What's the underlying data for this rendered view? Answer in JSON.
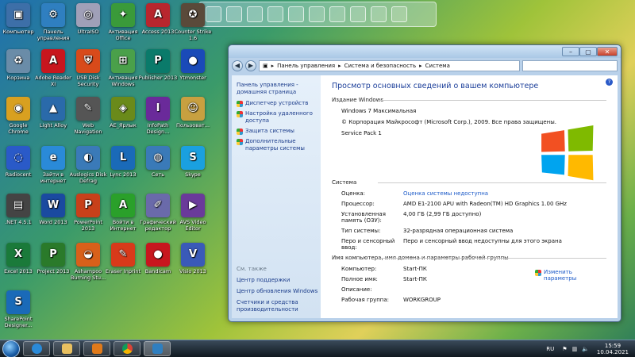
{
  "desktop_icons": [
    {
      "label": "Компьютер",
      "color": "#3d6fa8",
      "glyph": "▣"
    },
    {
      "label": "Панель управления",
      "color": "#2f7fc0",
      "glyph": "⚙"
    },
    {
      "label": "UltraISO",
      "color": "#a0a0b8",
      "glyph": "◎"
    },
    {
      "label": "Активация Office",
      "color": "#3a9a3a",
      "glyph": "✦"
    },
    {
      "label": "Access 2013",
      "color": "#b8262e",
      "glyph": "A"
    },
    {
      "label": "Counter Strike 1.6",
      "color": "#5a4a3a",
      "glyph": "✪"
    },
    {
      "label": "Корзина",
      "color": "#6a8ca8",
      "glyph": "♻"
    },
    {
      "label": "Adobe Reader XI",
      "color": "#c8161e",
      "glyph": "A"
    },
    {
      "label": "USB Disk Security",
      "color": "#d84a1a",
      "glyph": "⛨"
    },
    {
      "label": "Активация Windows",
      "color": "#4aa04a",
      "glyph": "⊞"
    },
    {
      "label": "Publisher 2013",
      "color": "#0a7a6a",
      "glyph": "P"
    },
    {
      "label": "Ytmonster",
      "color": "#1a4ab8",
      "glyph": "●"
    },
    {
      "label": "Google Chrome",
      "color": "#d8a020",
      "glyph": "◉"
    },
    {
      "label": "Light Alloy",
      "color": "#2a6aaa",
      "glyph": "▲"
    },
    {
      "label": "Web Navigation",
      "color": "#555",
      "glyph": "✎"
    },
    {
      "label": "АЕ_Ярлык",
      "color": "#6a8a1a",
      "glyph": "◈"
    },
    {
      "label": "InfoPath Design...",
      "color": "#6a2a9a",
      "glyph": "I"
    },
    {
      "label": "Пользоват...",
      "color": "#c8a040",
      "glyph": "☺"
    },
    {
      "label": "Radiocent",
      "color": "#2a5ac8",
      "glyph": "◌"
    },
    {
      "label": "Зайти в интернет",
      "color": "#2a8ad8",
      "glyph": "e"
    },
    {
      "label": "Auslogics Disk Defrag",
      "color": "#3a7ab8",
      "glyph": "◐"
    },
    {
      "label": "Lync 2013",
      "color": "#1a6ab8",
      "glyph": "L"
    },
    {
      "label": "Сеть",
      "color": "#3a7ab8",
      "glyph": "◍"
    },
    {
      "label": "Skype",
      "color": "#1aa0e0",
      "glyph": "S"
    },
    {
      "label": ".NET 4.5.1",
      "color": "#444",
      "glyph": "▤"
    },
    {
      "label": "Word 2013",
      "color": "#1a4aa0",
      "glyph": "W"
    },
    {
      "label": "PowerPoint 2013",
      "color": "#c8401a",
      "glyph": "P"
    },
    {
      "label": "Войти в Интернет",
      "color": "#2aa02a",
      "glyph": "A"
    },
    {
      "label": "Графический редактор",
      "color": "#6a6aaa",
      "glyph": "✐"
    },
    {
      "label": "AVS Video Editor",
      "color": "#6a3a9a",
      "glyph": "▶"
    },
    {
      "label": "Excel 2013",
      "color": "#1a7a3a",
      "glyph": "X"
    },
    {
      "label": "Project 2013",
      "color": "#2a7a2a",
      "glyph": "P"
    },
    {
      "label": "Ashampoo Burning Stu...",
      "color": "#d8601a",
      "glyph": "◒"
    },
    {
      "label": "Eraser Inprint",
      "color": "#d83a1a",
      "glyph": "✎"
    },
    {
      "label": "Bandicam",
      "color": "#c8161e",
      "glyph": "●"
    },
    {
      "label": "Visio 2013",
      "color": "#3a5ab8",
      "glyph": "V"
    },
    {
      "label": "SharePoint Designer...",
      "color": "#1a6ab8",
      "glyph": "S"
    }
  ],
  "window": {
    "breadcrumb": [
      "Панель управления",
      "Система и безопасность",
      "Система"
    ],
    "left_links": [
      "Панель управления - домашняя страница"
    ],
    "left_items": [
      "Диспетчер устройств",
      "Настройка удаленного доступа",
      "Защита системы",
      "Дополнительные параметры системы"
    ],
    "see_also_header": "См. также",
    "see_also": [
      "Центр поддержки",
      "Центр обновления Windows",
      "Счетчики и средства производительности"
    ],
    "heading": "Просмотр основных сведений о вашем компьютере",
    "edition_header": "Издание Windows",
    "edition": [
      "Windows 7 Максимальная",
      "© Корпорация Майкрософт (Microsoft Corp.), 2009. Все права защищены.",
      "Service Pack 1"
    ],
    "system_header": "Система",
    "system_rows": [
      {
        "k": "Оценка:",
        "v": "Оценка системы недоступна",
        "link": true
      },
      {
        "k": "Процессор:",
        "v": "AMD E1-2100 APU with Radeon(TM) HD Graphics      1.00 GHz"
      },
      {
        "k": "Установленная память (ОЗУ):",
        "v": "4,00 ГБ (2,99 ГБ доступно)"
      },
      {
        "k": "Тип системы:",
        "v": "32-разрядная операционная система"
      },
      {
        "k": "Перо и сенсорный ввод:",
        "v": "Перо и сенсорный ввод недоступны для этого экрана"
      }
    ],
    "computer_header": "Имя компьютера, имя домена и параметры рабочей группы",
    "computer_rows": [
      {
        "k": "Компьютер:",
        "v": "Start-ПК"
      },
      {
        "k": "Полное имя:",
        "v": "Start-ПК"
      },
      {
        "k": "Описание:",
        "v": ""
      },
      {
        "k": "Рабочая группа:",
        "v": "WORKGROUP"
      }
    ],
    "change_params": "Изменить параметры",
    "help_glyph": "?"
  },
  "taskbar": {
    "lang": "RU",
    "time": "15:59",
    "date": "10.04.2021"
  },
  "colors": {
    "accent": "#1c5ac8",
    "heading": "#1c3f9a"
  }
}
